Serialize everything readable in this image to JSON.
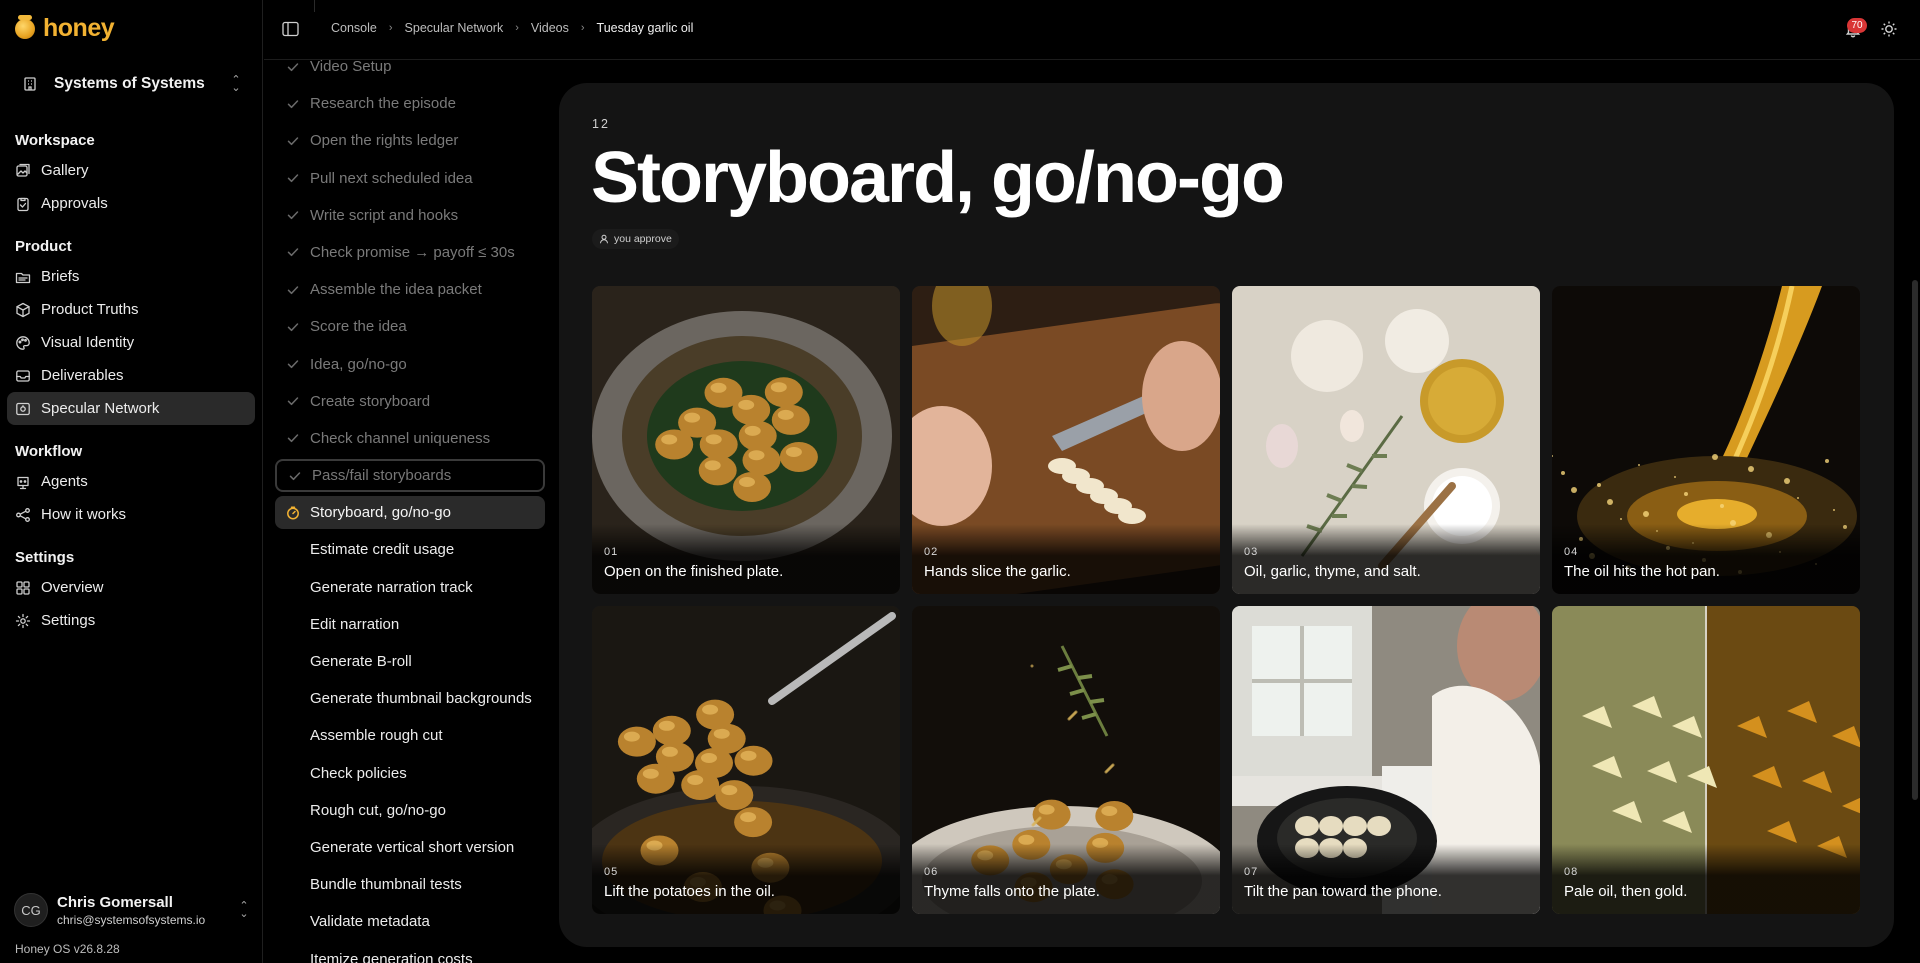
{
  "app": {
    "name": "honey",
    "version": "Honey OS v26.8.28",
    "brand_color": "#f2b232"
  },
  "org": {
    "name": "Systems of Systems"
  },
  "nav": [
    {
      "heading": "Workspace",
      "items": [
        {
          "label": "Gallery",
          "icon": "gallery-icon"
        },
        {
          "label": "Approvals",
          "icon": "clipboard-check-icon"
        }
      ]
    },
    {
      "heading": "Product",
      "items": [
        {
          "label": "Briefs",
          "icon": "folder-icon"
        },
        {
          "label": "Product Truths",
          "icon": "cube-icon"
        },
        {
          "label": "Visual Identity",
          "icon": "palette-icon"
        },
        {
          "label": "Deliverables",
          "icon": "inbox-icon"
        },
        {
          "label": "Specular Network",
          "icon": "screen-icon",
          "active": true
        }
      ]
    },
    {
      "heading": "Workflow",
      "items": [
        {
          "label": "Agents",
          "icon": "agent-icon"
        },
        {
          "label": "How it works",
          "icon": "flow-icon"
        }
      ]
    },
    {
      "heading": "Settings",
      "items": [
        {
          "label": "Overview",
          "icon": "grid-icon"
        },
        {
          "label": "Settings",
          "icon": "gear-icon"
        }
      ]
    }
  ],
  "user": {
    "initials": "CG",
    "name": "Chris Gomersall",
    "email": "chris@systemsofsystems.io"
  },
  "breadcrumb": [
    "Console",
    "Specular Network",
    "Videos",
    "Tuesday garlic oil"
  ],
  "notifications": {
    "count": "70"
  },
  "steps": [
    {
      "label": "Video Setup",
      "state": "done"
    },
    {
      "label": "Research the episode",
      "state": "done"
    },
    {
      "label": "Open the rights ledger",
      "state": "done"
    },
    {
      "label": "Pull next scheduled idea",
      "state": "done"
    },
    {
      "label": "Write script and hooks",
      "state": "done"
    },
    {
      "label": "Check promise → payoff ≤ 30s",
      "state": "done"
    },
    {
      "label": "Assemble the idea packet",
      "state": "done"
    },
    {
      "label": "Score the idea",
      "state": "done"
    },
    {
      "label": "Idea, go/no-go",
      "state": "done"
    },
    {
      "label": "Create storyboard",
      "state": "done"
    },
    {
      "label": "Check channel uniqueness",
      "state": "done"
    },
    {
      "label": "Pass/fail storyboards",
      "state": "outlined"
    },
    {
      "label": "Storyboard, go/no-go",
      "state": "current"
    },
    {
      "label": "Estimate credit usage",
      "state": "pending"
    },
    {
      "label": "Generate narration track",
      "state": "pending"
    },
    {
      "label": "Edit narration",
      "state": "pending"
    },
    {
      "label": "Generate B-roll",
      "state": "pending"
    },
    {
      "label": "Generate thumbnail backgrounds",
      "state": "pending"
    },
    {
      "label": "Assemble rough cut",
      "state": "pending"
    },
    {
      "label": "Check policies",
      "state": "pending"
    },
    {
      "label": "Rough cut, go/no-go",
      "state": "pending"
    },
    {
      "label": "Generate vertical short version",
      "state": "pending"
    },
    {
      "label": "Bundle thumbnail tests",
      "state": "pending"
    },
    {
      "label": "Validate metadata",
      "state": "pending"
    },
    {
      "label": "Itemize generation costs",
      "state": "pending"
    }
  ],
  "main": {
    "step_number": "12",
    "title": "Storyboard, go/no-go",
    "approver": "you approve",
    "frames": [
      {
        "num": "01",
        "caption": "Open on the finished plate."
      },
      {
        "num": "02",
        "caption": "Hands slice the garlic."
      },
      {
        "num": "03",
        "caption": "Oil, garlic, thyme, and salt."
      },
      {
        "num": "04",
        "caption": "The oil hits the hot pan."
      },
      {
        "num": "05",
        "caption": "Lift the potatoes in the oil."
      },
      {
        "num": "06",
        "caption": "Thyme falls onto the plate."
      },
      {
        "num": "07",
        "caption": "Tilt the pan toward the phone."
      },
      {
        "num": "08",
        "caption": "Pale oil, then gold."
      }
    ]
  }
}
